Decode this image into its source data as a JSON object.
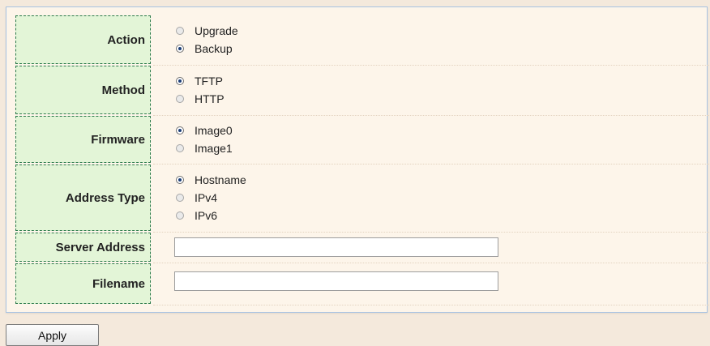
{
  "form": {
    "action": {
      "label": "Action",
      "options": [
        {
          "label": "Upgrade",
          "checked": false
        },
        {
          "label": "Backup",
          "checked": true
        }
      ]
    },
    "method": {
      "label": "Method",
      "options": [
        {
          "label": "TFTP",
          "checked": true
        },
        {
          "label": "HTTP",
          "checked": false
        }
      ]
    },
    "firmware": {
      "label": "Firmware",
      "options": [
        {
          "label": "Image0",
          "checked": true
        },
        {
          "label": "Image1",
          "checked": false
        }
      ]
    },
    "address_type": {
      "label": "Address Type",
      "options": [
        {
          "label": "Hostname",
          "checked": true
        },
        {
          "label": "IPv4",
          "checked": false
        },
        {
          "label": "IPv6",
          "checked": false
        }
      ]
    },
    "server_address": {
      "label": "Server Address",
      "value": ""
    },
    "filename": {
      "label": "Filename",
      "value": ""
    }
  },
  "apply_label": "Apply",
  "colors": {
    "label_bg": "#e3f5d7",
    "label_border": "#2b7a4b",
    "panel_bg": "#fdf5ea",
    "page_bg": "#f4e9dc"
  }
}
